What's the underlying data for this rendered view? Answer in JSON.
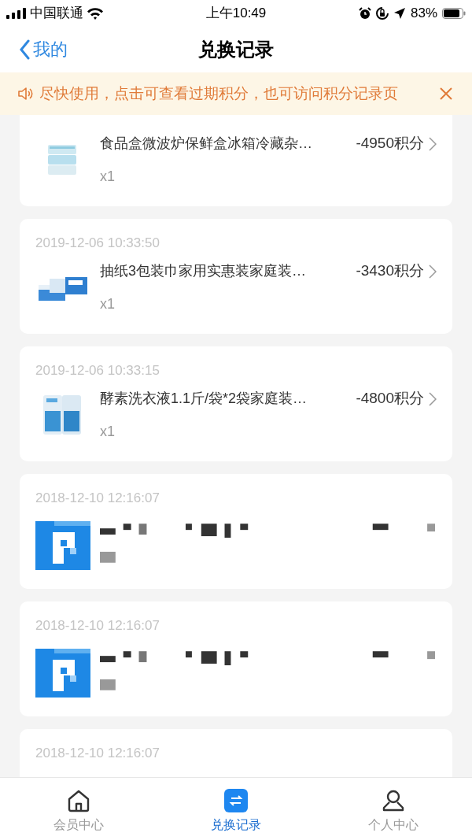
{
  "status_bar": {
    "carrier": "中国联通",
    "time": "上午10:49",
    "battery": "83%"
  },
  "nav": {
    "back": "我的",
    "title": "兑换记录"
  },
  "notice": {
    "text": "尽快使用，点击可查看过期积分，也可访问积分记录页"
  },
  "records": [
    {
      "kind": "product",
      "name": "食品盒微波炉保鲜盒冰箱冷藏杂…",
      "points": "-4950积分",
      "qty": "x1"
    },
    {
      "kind": "product",
      "time": "2019-12-06 10:33:50",
      "name": "抽纸3包装巾家用实惠装家庭装…",
      "points": "-3430积分",
      "qty": "x1"
    },
    {
      "kind": "product",
      "time": "2019-12-06 10:33:15",
      "name": "酵素洗衣液1.1斤/袋*2袋家庭装…",
      "points": "-4800积分",
      "qty": "x1"
    },
    {
      "kind": "redacted",
      "time": "2018-12-10 12:16:07"
    },
    {
      "kind": "redacted",
      "time": "2018-12-10 12:16:07"
    },
    {
      "kind": "cut",
      "time": "2018-12-10 12:16:07"
    }
  ],
  "tabs": [
    {
      "label": "会员中心",
      "selected": false
    },
    {
      "label": "兑换记录",
      "selected": true
    },
    {
      "label": "个人中心",
      "selected": false
    }
  ]
}
